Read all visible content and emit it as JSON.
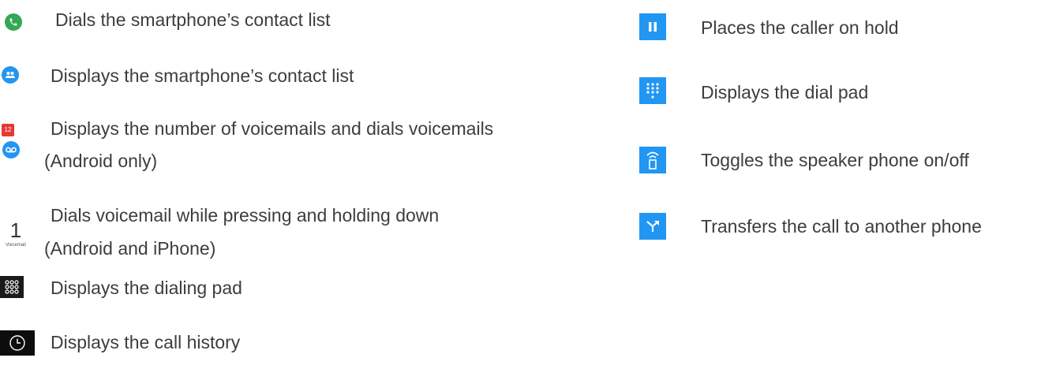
{
  "left": [
    {
      "icon": "phone-call-icon",
      "label": "Dials the smartphone’s contact list"
    },
    {
      "icon": "contacts-icon",
      "label": "Displays the smartphone’s contact list"
    },
    {
      "icon": "voicemail-badge-icon",
      "badge": "12",
      "label_line1": "Displays the number of voicemails and dials voicemails",
      "label_line2": "(Android only)"
    },
    {
      "icon": "voicemail-key-icon",
      "key_digit": "1",
      "key_caption": "Voicemail",
      "label_line1": "Dials voicemail while pressing and holding down",
      "label_line2": "(Android and iPhone)"
    },
    {
      "icon": "dialpad-grid-icon",
      "label": "Displays the dialing pad"
    },
    {
      "icon": "clock-icon",
      "label": "Displays the call history"
    }
  ],
  "right": [
    {
      "icon": "pause-icon",
      "label": "Places the caller on hold"
    },
    {
      "icon": "dialpad-icon",
      "label": "Displays the dial pad"
    },
    {
      "icon": "speaker-icon",
      "label": "Toggles the speaker phone on/off"
    },
    {
      "icon": "transfer-icon",
      "label": "Transfers the call to another phone"
    }
  ],
  "colors": {
    "green": "#34a853",
    "blue": "#2196f3",
    "red": "#e53935",
    "text": "#3d3d3d"
  }
}
